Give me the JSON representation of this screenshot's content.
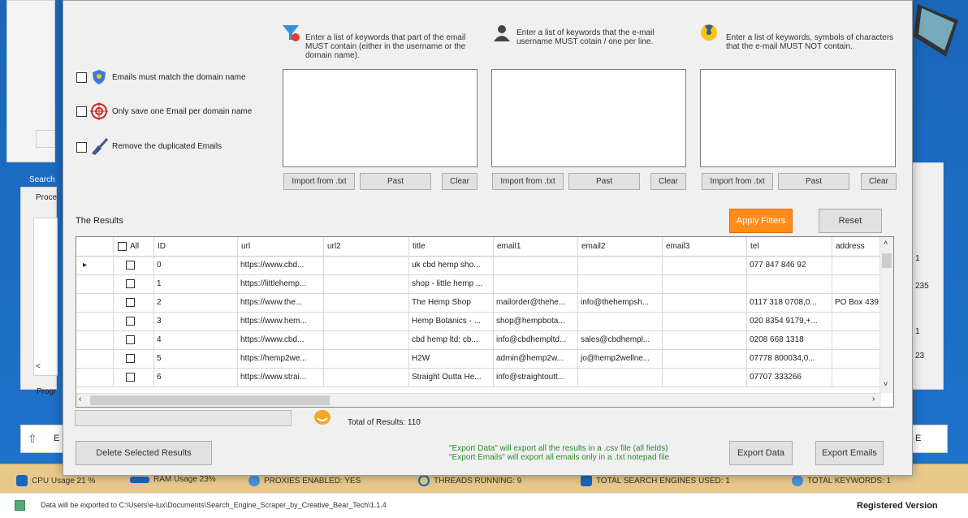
{
  "background": {
    "labels": {
      "search": "Search",
      "proc": "Proce",
      "progr": "Progr",
      "e_left": "E",
      "e_right": "E"
    },
    "numbers": {
      "n1": "1",
      "n2": "235",
      "n3": "1",
      "n4": "23"
    },
    "status": {
      "cpu": "CPU Usage 21 %",
      "ram": "RAM Usage 23%",
      "proxies": "PROXIES ENABLED: YES",
      "threads": "THREADS RUNNING: 9",
      "engines": "TOTAL SEARCH ENGINES USED: 1",
      "keywords": "TOTAL KEYWORDS: 1"
    },
    "footer": {
      "export_path": "Data will be exported to C:\\Users\\e-lux\\Documents\\Search_Engine_Scraper_by_Creative_Bear_Tech\\1.1.4",
      "version": "Registered Version"
    }
  },
  "options": {
    "match_domain": "Emails must match the domain name",
    "one_per_domain": "Only save one Email per domain name",
    "remove_duplicates": "Remove the duplicated Emails"
  },
  "keyword_panels": [
    {
      "hint": "Enter a list of keywords that part of the email MUST contain (either in the username or the domain name).",
      "import": "Import from .txt",
      "paste": "Past",
      "clear": "Clear"
    },
    {
      "hint": "Enter a list of keywords that the e-mail username MUST cotain / one per line.",
      "import": "Import from .txt",
      "paste": "Past",
      "clear": "Clear"
    },
    {
      "hint": "Enter a list of keywords, symbols of characters that the e-mail MUST NOT contain.",
      "import": "Import from .txt",
      "paste": "Past",
      "clear": "Clear"
    }
  ],
  "results": {
    "title": "The Results",
    "apply_filters": "Apply Filters",
    "reset": "Reset",
    "all_label": "All",
    "columns": [
      "ID",
      "url",
      "url2",
      "title",
      "email1",
      "email2",
      "email3",
      "tel",
      "address"
    ],
    "rows": [
      {
        "id": "0",
        "url": "https://www.cbd...",
        "url2": "",
        "title": "uk cbd hemp sho...",
        "email1": "",
        "email2": "",
        "email3": "",
        "tel": "077 847 846 92",
        "address": ""
      },
      {
        "id": "1",
        "url": "https://littlehemp...",
        "url2": "",
        "title": "shop - little hemp ...",
        "email1": "",
        "email2": "",
        "email3": "",
        "tel": "",
        "address": ""
      },
      {
        "id": "2",
        "url": "https://www.the...",
        "url2": "",
        "title": "The Hemp Shop",
        "email1": "mailorder@thehe...",
        "email2": "info@thehempsh...",
        "email3": "",
        "tel": "0117 318 0708,0...",
        "address": "PO Box 439"
      },
      {
        "id": "3",
        "url": "https://www.hem...",
        "url2": "",
        "title": "Hemp Botanics - ...",
        "email1": "shop@hempbota...",
        "email2": "",
        "email3": "",
        "tel": "020 8354 9179,+...",
        "address": ""
      },
      {
        "id": "4",
        "url": "https://www.cbd...",
        "url2": "",
        "title": "cbd hemp ltd: cb...",
        "email1": "info@cbdhempltd...",
        "email2": "sales@cbdhempl...",
        "email3": "",
        "tel": "0208 668 1318",
        "address": ""
      },
      {
        "id": "5",
        "url": "https://hemp2we...",
        "url2": "",
        "title": "H2W",
        "email1": "admin@hemp2w...",
        "email2": "jo@hemp2wellne...",
        "email3": "",
        "tel": "07778 800034,0...",
        "address": ""
      },
      {
        "id": "6",
        "url": "https://www.strai...",
        "url2": "",
        "title": "Straight Outta He...",
        "email1": "info@straightoutt...",
        "email2": "",
        "email3": "",
        "tel": "07707 333266",
        "address": ""
      }
    ],
    "total": "Total of Results: 110"
  },
  "actions": {
    "delete_selected": "Delete Selected Results",
    "note_line1": "\"Export Data\" will export all the results in a .csv file (all fields)",
    "note_line2": "\"Export Emails\" will export all emails only in a .txt notepad file",
    "export_data": "Export Data",
    "export_emails": "Export Emails"
  },
  "colors": {
    "accent": "#ff8c1a",
    "note_green": "#2e8b2e",
    "status_bar": "#e9c98a",
    "background_blue": "#1f74cc"
  }
}
